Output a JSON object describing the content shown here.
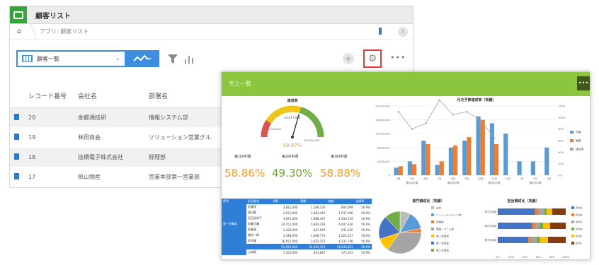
{
  "app": {
    "title": "顧客リスト",
    "breadcrumb": "アプリ: 顧客リスト",
    "info_label": "i",
    "view_name": "顧客一覧",
    "add_label": "+",
    "settings_label": "⚙",
    "more_label": "•••",
    "columns": [
      "レコード番号",
      "会社名",
      "部署名"
    ],
    "records": [
      {
        "number": "20",
        "company": "金都通技研",
        "dept": "情報システム部"
      },
      {
        "number": "19",
        "company": "林田商会",
        "dept": "ソリューション営業グル"
      },
      {
        "number": "18",
        "company": "技橋電子株式会社",
        "dept": "経理部"
      },
      {
        "number": "17",
        "company": "帆山物産",
        "dept": "営業本部第一営業部"
      }
    ]
  },
  "dashboard": {
    "header_title": "売上一覧",
    "more_label": "•••",
    "gauge": {
      "title": "達成率",
      "value_label": "33,617,000",
      "min_label": "0,000,000",
      "max_label": "100,000,000",
      "percent": "58.87%",
      "fraction": 0.5887
    },
    "kpis": [
      {
        "label": "第1四半期",
        "value": "58.86%",
        "color": "#f39a1e"
      },
      {
        "label": "第2四半期",
        "value": "49.30%",
        "color": "#6aa630"
      },
      {
        "label": "第3四半期",
        "value": "58.88%",
        "color": "#f39a1e"
      }
    ],
    "pivot": {
      "header": [
        "部門",
        "担当者名",
        "予算",
        "実績",
        "差額",
        "達成率"
      ],
      "group_label": "第一営業部",
      "rows": [
        [
          "佐藤茂",
          "3,821,000",
          "1,188,100",
          "803,099",
          "56.9%"
        ],
        [
          "渡辺健",
          "2,521,000",
          "1,883,416",
          "1,037,066",
          "56.9%"
        ],
        [
          "田辺佐知子",
          "3,873,000",
          "1,688,467",
          "1,330,519",
          "56.9%"
        ],
        [
          "加藤正義",
          "24,701,000",
          "3,683,378",
          "6,047,610",
          "56.9%"
        ],
        [
          "佐藤清",
          "1,433,000",
          "847,670",
          "931,120",
          "56.9%"
        ],
        [
          "福井一郎",
          "3,348,000",
          "1,468,773",
          "1,023,227",
          "56.9%"
        ],
        [
          "鈴木健",
          "36,055,000",
          "1,652,251",
          "4,231,748",
          "56.9%"
        ]
      ],
      "total_row": [
        "",
        "91,591,000",
        "34,502,574",
        "14,649,821",
        "56.9%"
      ],
      "last_row": [
        "山本聡",
        "1,163,000",
        "843,847",
        "373,263",
        "56.9%"
      ]
    }
  },
  "chart_data": [
    {
      "type": "bar",
      "title": "月次予算達成率（実績）",
      "categories": [
        "4月",
        "5月",
        "6月",
        "7月",
        "8月",
        "9月",
        "10月",
        "11月",
        "12月",
        "1月",
        "2月",
        "3月"
      ],
      "quarter_labels": [
        "第1四半期",
        "第2四半期",
        "第3四半期",
        "第4四半期"
      ],
      "ylim": [
        0,
        20000000
      ],
      "y_ticks": [
        "20,000,000",
        "16,000,000",
        "12,000,000",
        "8,000,000",
        "4,000,000",
        "0"
      ],
      "y2_ticks": [
        "120%",
        "100%",
        "80%",
        "60%",
        "40%",
        "20%",
        "0%"
      ],
      "legend_position": "right",
      "series": [
        {
          "name": "予算",
          "color": "#5b9bd5",
          "values": [
            2200000,
            4000000,
            10000000,
            3000000,
            8000000,
            10000000,
            17000000,
            15000000,
            12000000,
            4000000,
            4000000,
            8000000
          ]
        },
        {
          "name": "実績",
          "color": "#ed7d31",
          "values": [
            2600000,
            3200000,
            9000000,
            4000000,
            8600000,
            11000000,
            16000000,
            9000000,
            0,
            0,
            0,
            0
          ]
        },
        {
          "name": "達成率",
          "color": "#a5a5a5",
          "type": "line",
          "values": [
            110,
            80,
            90,
            130,
            105,
            110,
            95,
            65,
            0,
            0,
            0,
            0
          ]
        }
      ]
    },
    {
      "type": "pie",
      "title": "部門構成比（実績）",
      "categories": [
        "全体",
        "ソーシャルメディア部",
        "営業部",
        "情報システム部",
        "第一営業部",
        "第二営業部",
        "第三営業部"
      ],
      "values": [
        8,
        14,
        3,
        35,
        10,
        18,
        12
      ],
      "colors": [
        "#bbbbbb",
        "#5b9bd5",
        "#ed7d31",
        "#a5a5a5",
        "#ffc000",
        "#4472c4",
        "#70ad47"
      ],
      "legend_position": "right"
    },
    {
      "type": "bar",
      "stacked": true,
      "horizontal": true,
      "title": "担当構成比（実績）",
      "categories": [
        "第1四半期",
        "第2四半期",
        "第3四半期"
      ],
      "x_ticks": [
        "0%",
        "20%",
        "40%",
        "60%",
        "80%",
        "100%"
      ],
      "series": [
        {
          "name": "担当A",
          "color": "#4472c4",
          "values": [
            0.55,
            0.5,
            0.45
          ]
        },
        {
          "name": "担当B",
          "color": "#ed7d31",
          "values": [
            0.05,
            0.06,
            0.04
          ]
        },
        {
          "name": "担当C",
          "color": "#a5a5a5",
          "values": [
            0.08,
            0.06,
            0.08
          ]
        },
        {
          "name": "担当D",
          "color": "#70ad47",
          "values": [
            0.04,
            0.05,
            0.05
          ]
        },
        {
          "name": "担当E",
          "color": "#ffc000",
          "values": [
            0.08,
            0.1,
            0.12
          ]
        },
        {
          "name": "担当F",
          "color": "#843c0c",
          "values": [
            0.2,
            0.23,
            0.26
          ]
        }
      ],
      "legend_position": "right"
    }
  ]
}
